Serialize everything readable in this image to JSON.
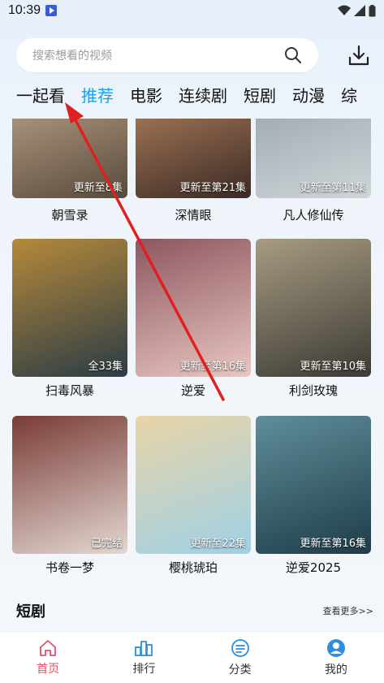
{
  "status": {
    "time": "10:39"
  },
  "search": {
    "placeholder": "搜索想看的视频"
  },
  "tabs": [
    "一起看",
    "推荐",
    "电影",
    "连续剧",
    "短剧",
    "动漫",
    "综"
  ],
  "active_tab": 1,
  "cards": [
    {
      "title": "朝雪录",
      "badge": "更新至8集",
      "colors": [
        "#5a4a3a",
        "#c9b49a"
      ]
    },
    {
      "title": "深情眼",
      "badge": "更新至第21集",
      "colors": [
        "#3b2a24",
        "#c8926a"
      ]
    },
    {
      "title": "凡人修仙传",
      "badge": "更新至第11集",
      "colors": [
        "#cfd6d8",
        "#8c9aa3"
      ]
    },
    {
      "title": "扫毒风暴",
      "badge": "全33集",
      "colors": [
        "#2b3c46",
        "#b5893a"
      ]
    },
    {
      "title": "逆爱",
      "badge": "更新至第16集",
      "colors": [
        "#e9c7c1",
        "#8d5660"
      ]
    },
    {
      "title": "利剑玫瑰",
      "badge": "更新至第10集",
      "colors": [
        "#3c3a34",
        "#a79c82"
      ]
    },
    {
      "title": "书卷一梦",
      "badge": "已完结",
      "colors": [
        "#e3d8d2",
        "#7a3b36"
      ]
    },
    {
      "title": "樱桃琥珀",
      "badge": "更新至22集",
      "colors": [
        "#9fd1e6",
        "#e8d4a8"
      ]
    },
    {
      "title": "逆爱2025",
      "badge": "更新至第16集",
      "colors": [
        "#1f3c4a",
        "#5f8e9a"
      ]
    }
  ],
  "section": {
    "title": "短剧",
    "more": "查看更多>>"
  },
  "nav": [
    {
      "label": "首页",
      "icon": "home-icon"
    },
    {
      "label": "排行",
      "icon": "ranking-icon"
    },
    {
      "label": "分类",
      "icon": "category-icon"
    },
    {
      "label": "我的",
      "icon": "profile-icon"
    }
  ],
  "colors": {
    "accent": "#1e9fe6",
    "nav_active": "#e24f6b",
    "arrow": "#e02020"
  }
}
